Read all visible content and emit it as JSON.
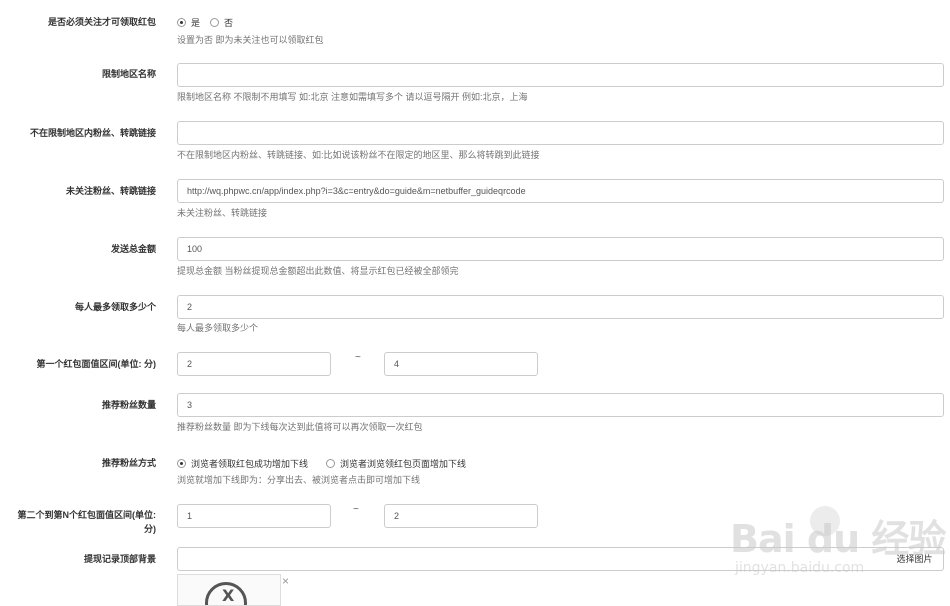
{
  "follow_required": {
    "label": "是否必须关注才可领取红包",
    "option_yes": "是",
    "option_no": "否",
    "selected": "yes",
    "help": "设置为否 即为未关注也可以领取红包"
  },
  "region_name": {
    "label": "限制地区名称",
    "value": "",
    "help": "限制地区名称 不限制不用填写 如:北京 注意如需填写多个 请以逗号隔开 例如:北京，上海"
  },
  "outside_region_link": {
    "label": "不在限制地区内粉丝、转跳链接",
    "value": "",
    "help": "不在限制地区内粉丝、转跳链接、如:比如说该粉丝不在限定的地区里、那么将转跳到此链接"
  },
  "unfollowed_link": {
    "label": "未关注粉丝、转跳链接",
    "value": "http://wq.phpwc.cn/app/index.php?i=3&c=entry&do=guide&m=netbuffer_guideqrcode",
    "help": "未关注粉丝、转跳链接"
  },
  "total_amount": {
    "label": "发送总金额",
    "value": "100",
    "help": "提现总金额 当粉丝提现总金额超出此数值、将显示红包已经被全部领完"
  },
  "max_per_person": {
    "label": "每人最多领取多少个",
    "value": "2",
    "help": "每人最多领取多少个"
  },
  "first_range": {
    "label": "第一个红包面值区间(单位: 分)",
    "min": "2",
    "separator": "~",
    "max": "4"
  },
  "referral_count": {
    "label": "推荐粉丝数量",
    "value": "3",
    "help": "推荐粉丝数量 即为下线每次达到此值将可以再次领取一次红包"
  },
  "referral_method": {
    "label": "推荐粉丝方式",
    "option_a": "浏览者领取红包成功增加下线",
    "option_b": "浏览者浏览领红包页面增加下线",
    "selected": "a",
    "help": "浏览就增加下线即为：分享出去、被浏览者点击即可增加下线"
  },
  "nth_range": {
    "label_line1": "第二个到第N个红包面值区间(单位:",
    "label_line2": "分)",
    "min": "1",
    "separator": "~",
    "max": "2"
  },
  "withdraw_bg": {
    "label": "提现记录顶部背景",
    "value": "",
    "button": "选择图片",
    "remove": "×"
  },
  "watermark": {
    "main": "Bai du 经验",
    "sub": "jingyan.baidu.com"
  }
}
